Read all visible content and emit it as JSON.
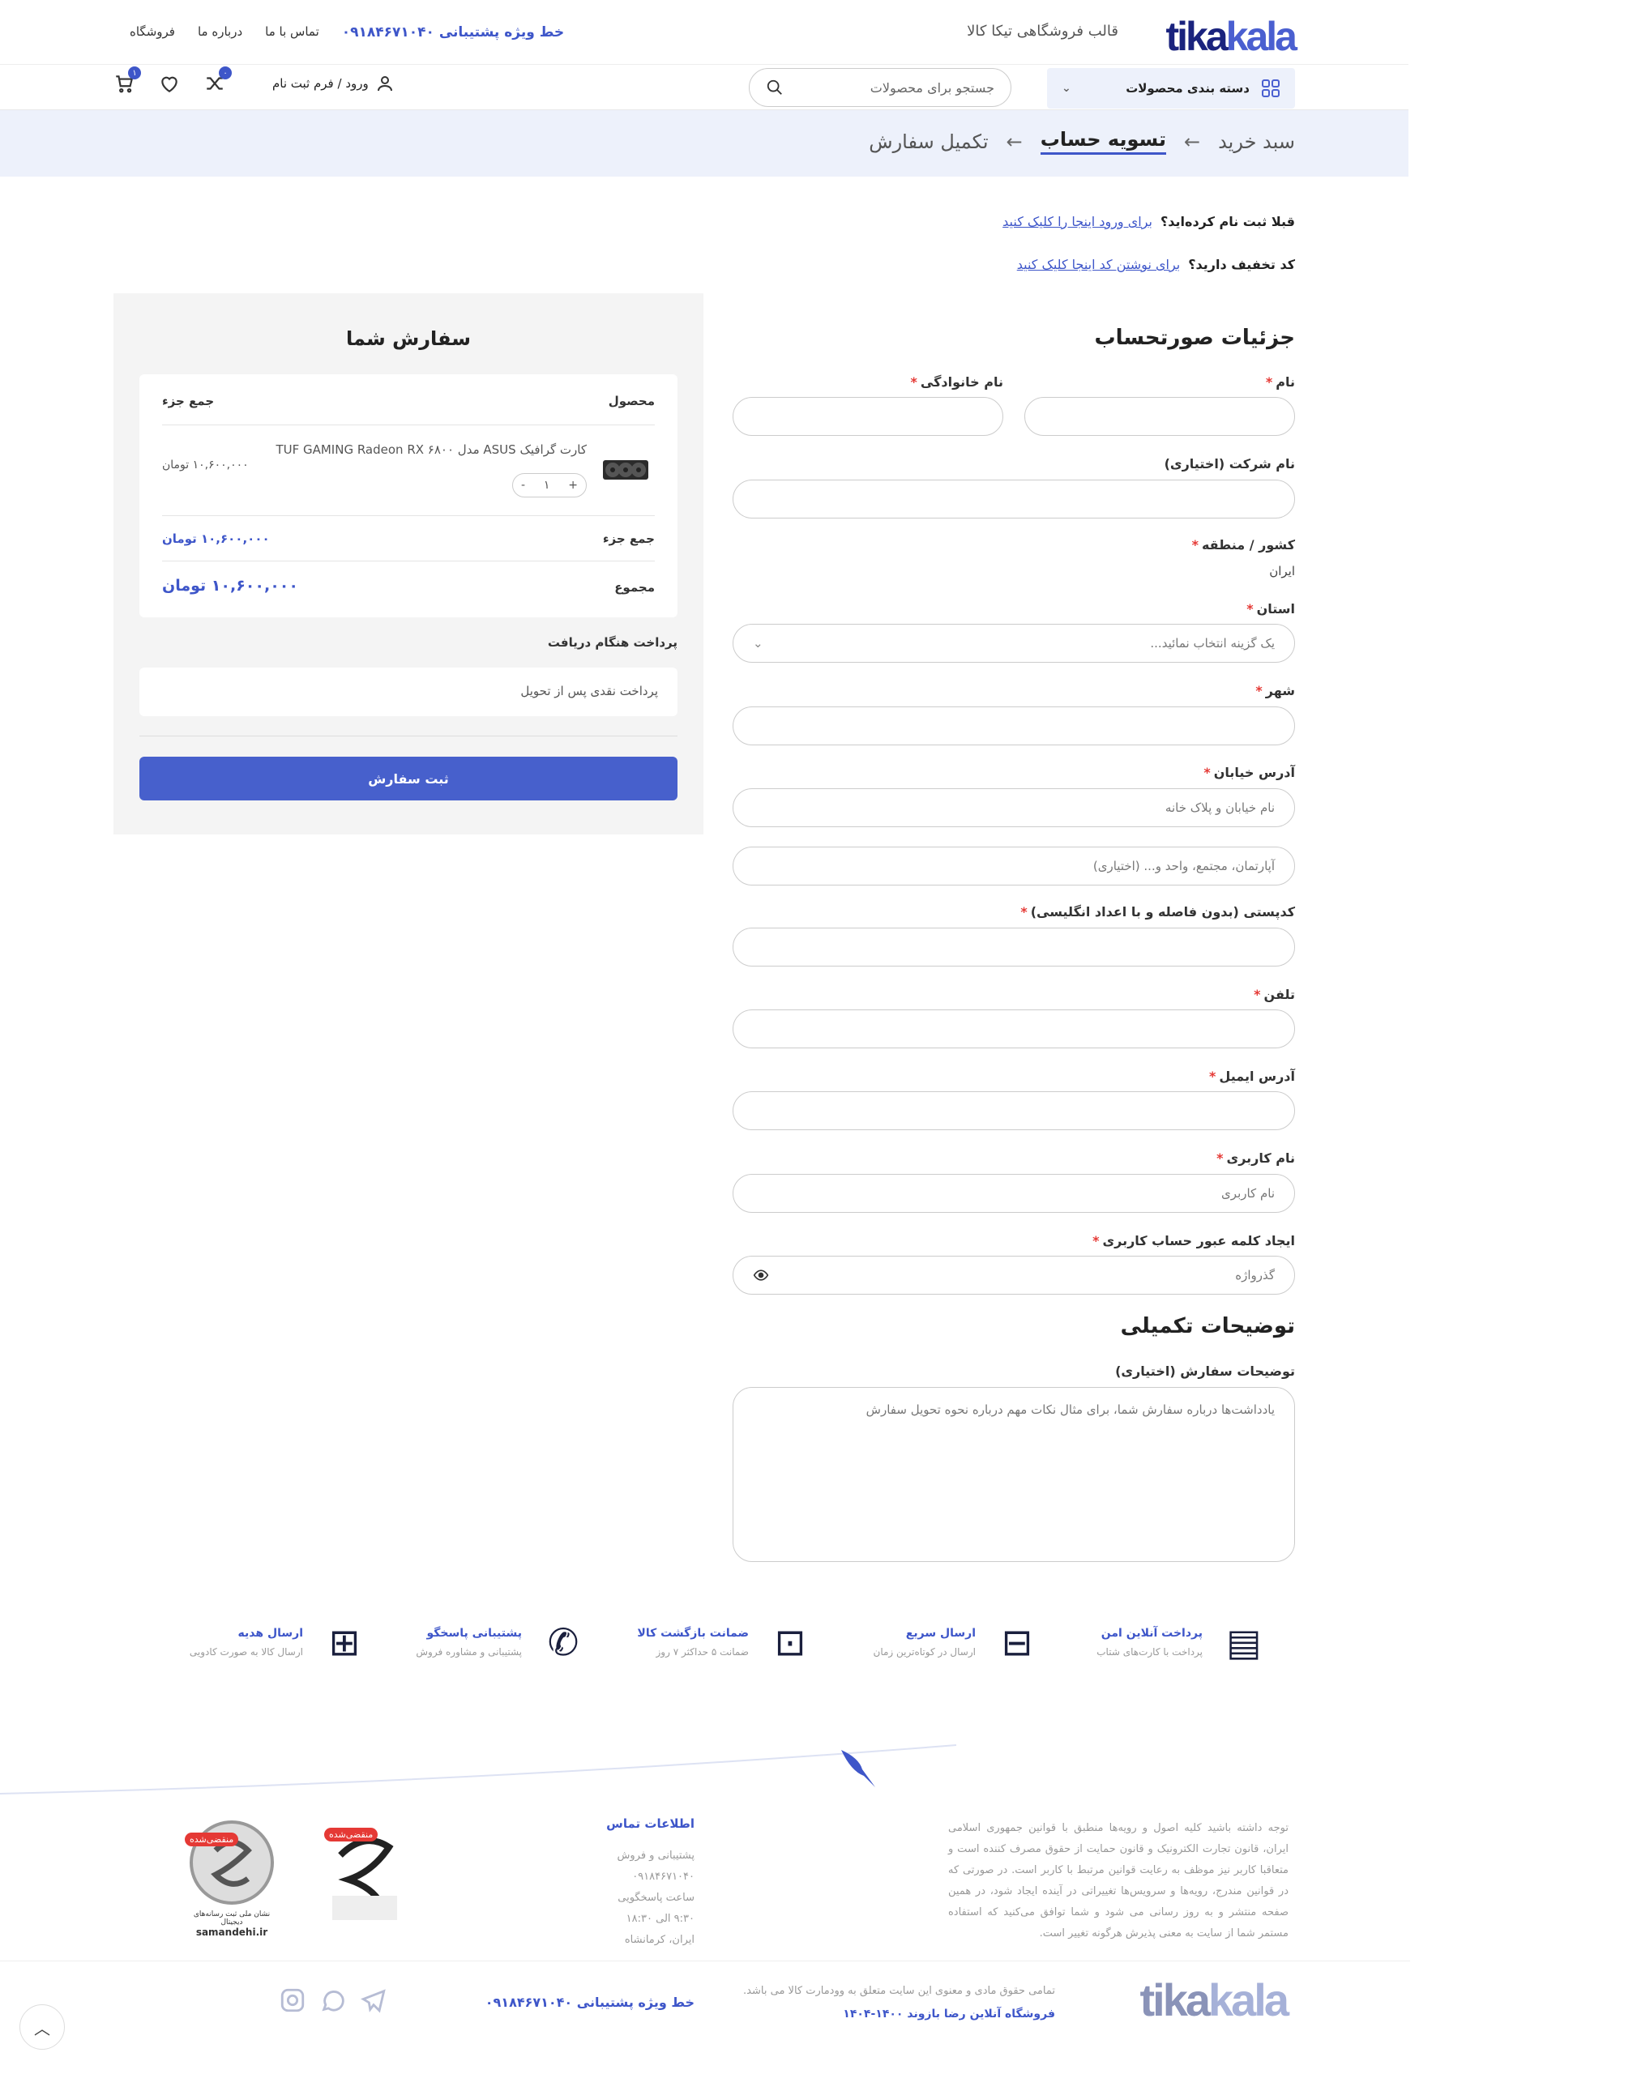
{
  "header": {
    "tagline": "قالب فروشگاهی تیکا کالا",
    "logo_tika": "tika",
    "logo_kala": "kala",
    "nav": [
      "فروشگاه",
      "درباره ما",
      "تماس با ما"
    ],
    "hotline": "خط ویژه پشتیبانی ۰۹۱۸۴۶۷۱۰۴۰",
    "categories_label": "دسته بندی محصولات",
    "search_placeholder": "جستجو برای محصولات",
    "cart_count": "۱",
    "compare_count": "۰",
    "login_label": "ورود / فرم ثبت نام"
  },
  "breadcrumb": {
    "step1": "سبد خرید",
    "step2": "تسویه حساب",
    "step3": "تکمیل سفارش",
    "arrow": "←"
  },
  "notices": {
    "login_q": "قبلا ثبت نام کرده‌اید؟",
    "login_link": "برای ورود اینجا را کلیک کنید",
    "coupon_q": "کد تخفیف دارید؟",
    "coupon_link": "برای نوشتن کد اینجا کلیک کنید"
  },
  "billing": {
    "title": "جزئیات صورتحساب",
    "first_name": "نام",
    "last_name": "نام خانوادگی",
    "company": "نام شرکت (اختیاری)",
    "country": "کشور / منطقه",
    "country_value": "ایران",
    "state": "استان",
    "state_placeholder": "یک گزینه انتخاب نمائید...",
    "city": "شهر",
    "address": "آدرس خیابان",
    "address_placeholder": "نام خیابان و پلاک خانه",
    "address2_placeholder": "آپارتمان، مجتمع، واحد و... (اختیاری)",
    "postcode": "کدپستی (بدون فاصله و با اعداد انگلیسی)",
    "phone": "تلفن",
    "email": "آدرس ایمیل",
    "username": "نام کاربری",
    "username_placeholder": "نام کاربری",
    "password": "ایجاد کلمه عبور حساب کاربری",
    "password_placeholder": "گذرواژه",
    "extra_title": "توضیحات تکمیلی",
    "notes_label": "توضیحات سفارش (اختیاری)",
    "notes_placeholder": "یادداشت‌ها درباره سفارش شما، برای مثال نکات مهم درباره نحوه تحویل سفارش"
  },
  "order": {
    "title": "سفارش شما",
    "col_product": "محصول",
    "col_subtotal": "جمع جزء",
    "product_name": "کارت گرافیک ASUS مدل TUF GAMING Radeon RX ۶۸۰۰",
    "product_price": "۱۰,۶۰۰,۰۰۰ تومان",
    "qty": "۱",
    "qty_minus": "-",
    "qty_plus": "+",
    "subtotal_label": "جمع جزء",
    "subtotal_value": "۱۰,۶۰۰,۰۰۰ تومان",
    "total_label": "مجموع",
    "total_value": "۱۰,۶۰۰,۰۰۰ تومان",
    "payment_title": "پرداخت هنگام دریافت",
    "payment_desc": "پرداخت نقدی پس از تحویل",
    "submit": "ثبت سفارش"
  },
  "features": [
    {
      "title": "پرداخت آنلاین امن",
      "sub": "پرداخت با کارت‌های شتاب",
      "icon": "card-icon"
    },
    {
      "title": "ارسال سریع",
      "sub": "ارسال در کوتاه‌ترین زمان",
      "icon": "truck-icon"
    },
    {
      "title": "ضمانت بازگشت کالا",
      "sub": "ضمانت ۵ حداکثر ۷ روز",
      "icon": "box-icon"
    },
    {
      "title": "پشتیبانی پاسخگو",
      "sub": "پشتیبانی و مشاوره فروش",
      "icon": "phone-icon"
    },
    {
      "title": "ارسال هدیه",
      "sub": "ارسال کالا به صورت کادویی",
      "icon": "gift-icon"
    }
  ],
  "footer": {
    "about": "توجه داشته باشید کلیه اصول و رویه‌ها منطبق با قوانین جمهوری اسلامی ایران، قانون تجارت الکترونیک و قانون حمایت از حقوق مصرف کننده است و متعاقبا کاربر نیز موظف به رعایت قوانین مرتبط با کاربر است. در صورتی که در قوانین مندرج، رویه‌ها و سرویس‌ها تغییراتی در آینده ایجاد شود، در همین صفحه منتشر و به روز رسانی می شود و شما توافق می‌کنید که استفاده مستمر شما از سایت به معنی پذیرش هرگونه تغییر است.",
    "contact_title": "اطلاعات تماس",
    "contact_lines": [
      "پشتیبانی و فروش",
      "۰۹۱۸۴۶۷۱۰۴۰",
      "ساعت پاسخگویی",
      "۹:۳۰ الی ۱۸:۳۰",
      "ایران، کرمانشاه"
    ],
    "badge1_text": "منقضی‌شده",
    "badge2_text": "منقضی‌شده",
    "samandehi_text": "نشان ملی ثبت رسانه‌های دیجیتال",
    "samandehi_url": "samandehi.ir",
    "copyright": "تمامی حقوق مادی و معنوی این سایت متعلق به وودمارت کالا می باشد.",
    "shop_name": "فروشگاه آنلاین رضا بازوند ۱۴۰۰-۱۴۰۴",
    "hotline": "خط ویژه پشتیبانی ۰۹۱۸۴۶۷۱۰۴۰",
    "logo_tika": "tika",
    "logo_kala": "kala",
    "scroll_top": "︿"
  }
}
